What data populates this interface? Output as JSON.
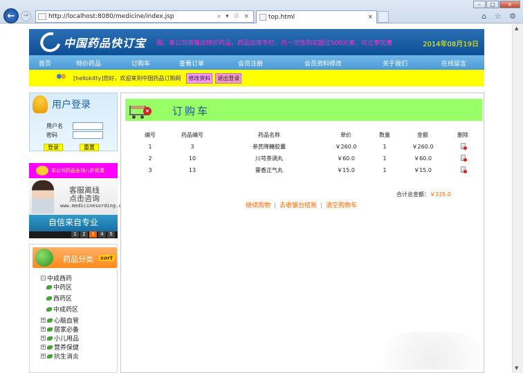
{
  "browser": {
    "url": "http://localhost:8080/medicine/index.jsp",
    "tab_title": "top.html",
    "addr_tools": "⌕ ▾ ♲ ×",
    "tab_close": "×",
    "right_icons": "⌂ ☆ ⚙",
    "back_glyph": "←",
    "fwd_glyph": "→",
    "win_min": "–",
    "win_max": "□",
    "win_close": "×",
    "scroll_up": "▲",
    "scroll_down": "▼"
  },
  "header": {
    "logo_text": "中国药品快订宝",
    "marquee": "国，本公司将推出特价药品，药品出库专栏，凡一次性购买超过500元者，可立享优惠",
    "date": "2014年08月19日"
  },
  "menu": [
    "首页",
    "特价药品",
    "订购车",
    "查看订单",
    "会员注册",
    "会员资料修改",
    "关于我们",
    "在线留言"
  ],
  "welcome": {
    "text": "[hellokitty]您好，欢迎来到中国药品订购网",
    "edit_label": "修改资料",
    "logout_label": "退出登录"
  },
  "login": {
    "title": "用户登录",
    "username_label": "用户名",
    "password_label": "密码",
    "login_button": "登录",
    "reset_button": "重置"
  },
  "promo": {
    "text": "本公司药品全场八折优惠",
    "service_line1": "客服离线",
    "service_line2": "点击咨询",
    "service_site": "www.medicinesording.com",
    "slogan": "自信来自专业",
    "pages": [
      "1",
      "2",
      "3",
      "4",
      "5"
    ],
    "active_page": "3"
  },
  "categories": {
    "title": "药品分类",
    "sort_tag": "sort",
    "expanded": "中成西药",
    "sub_items": [
      "中药区",
      "西药区",
      "中成药区"
    ],
    "collapsed": [
      "心脑血管",
      "居家必备",
      "小儿用品",
      "营养保健",
      "抗生消炎"
    ]
  },
  "cart": {
    "title": "订购车",
    "columns": [
      "编号",
      "药品编号",
      "药品名称",
      "单价",
      "数量",
      "金额",
      "删除"
    ],
    "rows": [
      [
        "1",
        "3",
        "参芪降糖胶囊",
        "￥260.0",
        "1",
        "￥260.0"
      ],
      [
        "2",
        "10",
        "川芎茶调丸",
        "￥60.0",
        "1",
        "￥60.0"
      ],
      [
        "3",
        "13",
        "藿香正气丸",
        "￥15.0",
        "1",
        "￥15.0"
      ]
    ],
    "total_label": "合计总金额：",
    "total_value": "￥335.0",
    "actions": [
      "继续购物",
      "去收银台结账",
      "清空购物车"
    ]
  },
  "colors": {
    "banner": "#0d4f96",
    "menubar": "#4c9ad6",
    "welcome_bg": "#ffff00",
    "cart_header": "#99ff66",
    "action_link": "#ff6600",
    "marquee": "#ff33cc"
  }
}
